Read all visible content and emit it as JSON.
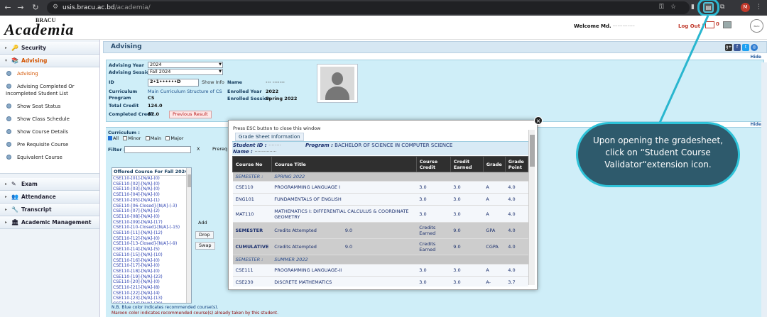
{
  "browser": {
    "url_host": "usis.bracu.ac.bd",
    "url_path": "/academia/",
    "profile_initial": "M"
  },
  "header": {
    "logo_top": "BRACU",
    "logo_main": "Academia",
    "welcome_label": "Welcome Md.",
    "welcome_name": " ··················",
    "logout": "Log Out |",
    "mail_count": "0"
  },
  "sidebar": {
    "sections": [
      {
        "label": "Security"
      },
      {
        "label": "Advising"
      }
    ],
    "advising_items": [
      {
        "label": "Advising"
      },
      {
        "label": "Advising Completed Or Incompleted Student List"
      },
      {
        "label": "Show Seat Status"
      },
      {
        "label": "Show Class Schedule"
      },
      {
        "label": "Show Course Details"
      },
      {
        "label": "Pre Requisite Course"
      },
      {
        "label": "Equivalent Course"
      }
    ],
    "lower_sections": [
      {
        "label": "Exam"
      },
      {
        "label": "Attendance"
      },
      {
        "label": "Transcript"
      },
      {
        "label": "Academic Management"
      }
    ]
  },
  "main": {
    "title": "Advising",
    "hide": "Hide",
    "advising_year_label": "Advising Year",
    "advising_year": "2024",
    "advising_session_label": "Advising Session",
    "advising_session": "Fall 2024",
    "id_label": "ID",
    "id_value": "2•1••••••D",
    "show_info": "Show Info",
    "curriculum_label": "Curriculum",
    "curriculum_value": "Main Curriculum Structure of CS",
    "program_label": "Program",
    "program_value": "CS",
    "total_credit_label": "Total Credit",
    "total_credit_value": "124.0",
    "completed_credit_label": "Completed Credit",
    "completed_credit_value": "87.0",
    "previous_result": "Previous Result",
    "name_label": "Name",
    "name_value": "··· ·······",
    "enrolled_year_label": "Enrolled Year",
    "enrolled_year_value": "2022",
    "enrolled_session_label": "Enrolled Session",
    "enrolled_session_value": "Spring 2022",
    "curriculum_filter_label": "Curriculum :",
    "chk_all": "All",
    "chk_minor": "Minor",
    "chk_main": "Main",
    "chk_major": "Major",
    "filter_label": "Filter :",
    "x_button": "X",
    "prereq_button": "Prereq",
    "offered_label": "Offered Course For Fall 2024",
    "offered_courses": [
      "CSE110-[01]-[N/A]-(0)",
      "CSE110-[02]-[N/A]-(0)",
      "CSE110-[03]-[N/A]-(0)",
      "CSE110-[04]-[N/A]-(0)",
      "CSE110-[05]-[N/A]-(1)",
      "CSE110-[06-Closed]-[N/A]-(-3)",
      "CSE110-[07]-[N/A]-(2)",
      "CSE110-[08]-[N/A]-(0)",
      "CSE110-[09]-[N/A]-(17)",
      "CSE110-[10-Closed]-[N/A]-(-15)",
      "CSE110-[11]-[N/A]-(12)",
      "CSE110-[12]-[N/A]-(0)",
      "CSE110-[13-Closed]-[N/A]-(-9)",
      "CSE110-[14]-[N/A]-(5)",
      "CSE110-[15]-[N/A]-(10)",
      "CSE110-[16]-[N/A]-(0)",
      "CSE110-[17]-[N/A]-(0)",
      "CSE110-[18]-[N/A]-(0)",
      "CSE110-[19]-[N/A]-(23)",
      "CSE110-[20]-[N/A]-(0)",
      "CSE110-[21]-[N/A]-(8)",
      "CSE110-[22]-[N/A]-(4)",
      "CSE110-[23]-[N/A]-(13)",
      "CSE110-[24]-[N/A]-(38)",
      "CSE110-[25-Closed]-[N/A]-(-3)"
    ],
    "add_button": "Add",
    "drop_button": "Drop",
    "swap_button": "Swap",
    "note_blue": "N.B. Blue color indicates recommended course(s).",
    "note_maroon": "Maroon color indicates recommended course(s) already taken by this student."
  },
  "popup": {
    "esc_text": "Press ESC button to close this window",
    "tab": "Grade Sheet Information",
    "student_id_label": "Student ID :",
    "student_id_value": "········",
    "name_label": "Name :",
    "name_value": "················",
    "program_label": "Program :",
    "program_value": "BACHELOR OF SCIENCE IN COMPUTER SCIENCE",
    "columns": [
      "Course No",
      "Course Title",
      "Course Credit",
      "Credit Earned",
      "Grade",
      "Grade Point"
    ],
    "rows": [
      {
        "kind": "sem",
        "label": "SEMESTER :",
        "value": "SPRING 2022"
      },
      {
        "kind": "crs",
        "no": "CSE110",
        "title": "PROGRAMMING LANGUAGE I",
        "credit": "3.0",
        "earned": "3.0",
        "grade": "A",
        "point": "4.0"
      },
      {
        "kind": "crs",
        "no": "ENG101",
        "title": "FUNDAMENTALS OF ENGLISH",
        "credit": "3.0",
        "earned": "3.0",
        "grade": "A",
        "point": "4.0"
      },
      {
        "kind": "crs2",
        "no": "MAT110",
        "title": "MATHEMATICS I: DIFFERENTIAL CALCULUS & COORDINATE GEOMETRY",
        "credit": "3.0",
        "earned": "3.0",
        "grade": "A",
        "point": "4.0"
      },
      {
        "kind": "sum",
        "no": "SEMESTER",
        "title": "Credits Attempted",
        "attempted": "9.0",
        "credit": "Credits Earned",
        "earned": "9.0",
        "grade": "GPA",
        "point": "4.0"
      },
      {
        "kind": "sum",
        "no": "CUMULATIVE",
        "title": "Credits Attempted",
        "attempted": "9.0",
        "credit": "Credits Earned",
        "earned": "9.0",
        "grade": "CGPA",
        "point": "4.0"
      },
      {
        "kind": "sem",
        "label": "SEMESTER :",
        "value": "SUMMER 2022"
      },
      {
        "kind": "crs",
        "no": "CSE111",
        "title": "PROGRAMMING LANGUAGE-II",
        "credit": "3.0",
        "earned": "3.0",
        "grade": "A",
        "point": "4.0"
      },
      {
        "kind": "crs",
        "no": "CSE230",
        "title": "DISCRETE MATHEMATICS",
        "credit": "3.0",
        "earned": "3.0",
        "grade": "A-",
        "point": "3.7"
      }
    ]
  },
  "callout": {
    "text": "Upon opening the gradesheet, click on “Student Course Validator“extension icon."
  },
  "colors": {
    "accent": "#29b6cf",
    "callout_bg": "#2e5a6c",
    "panel_bg": "#cfeef8"
  }
}
